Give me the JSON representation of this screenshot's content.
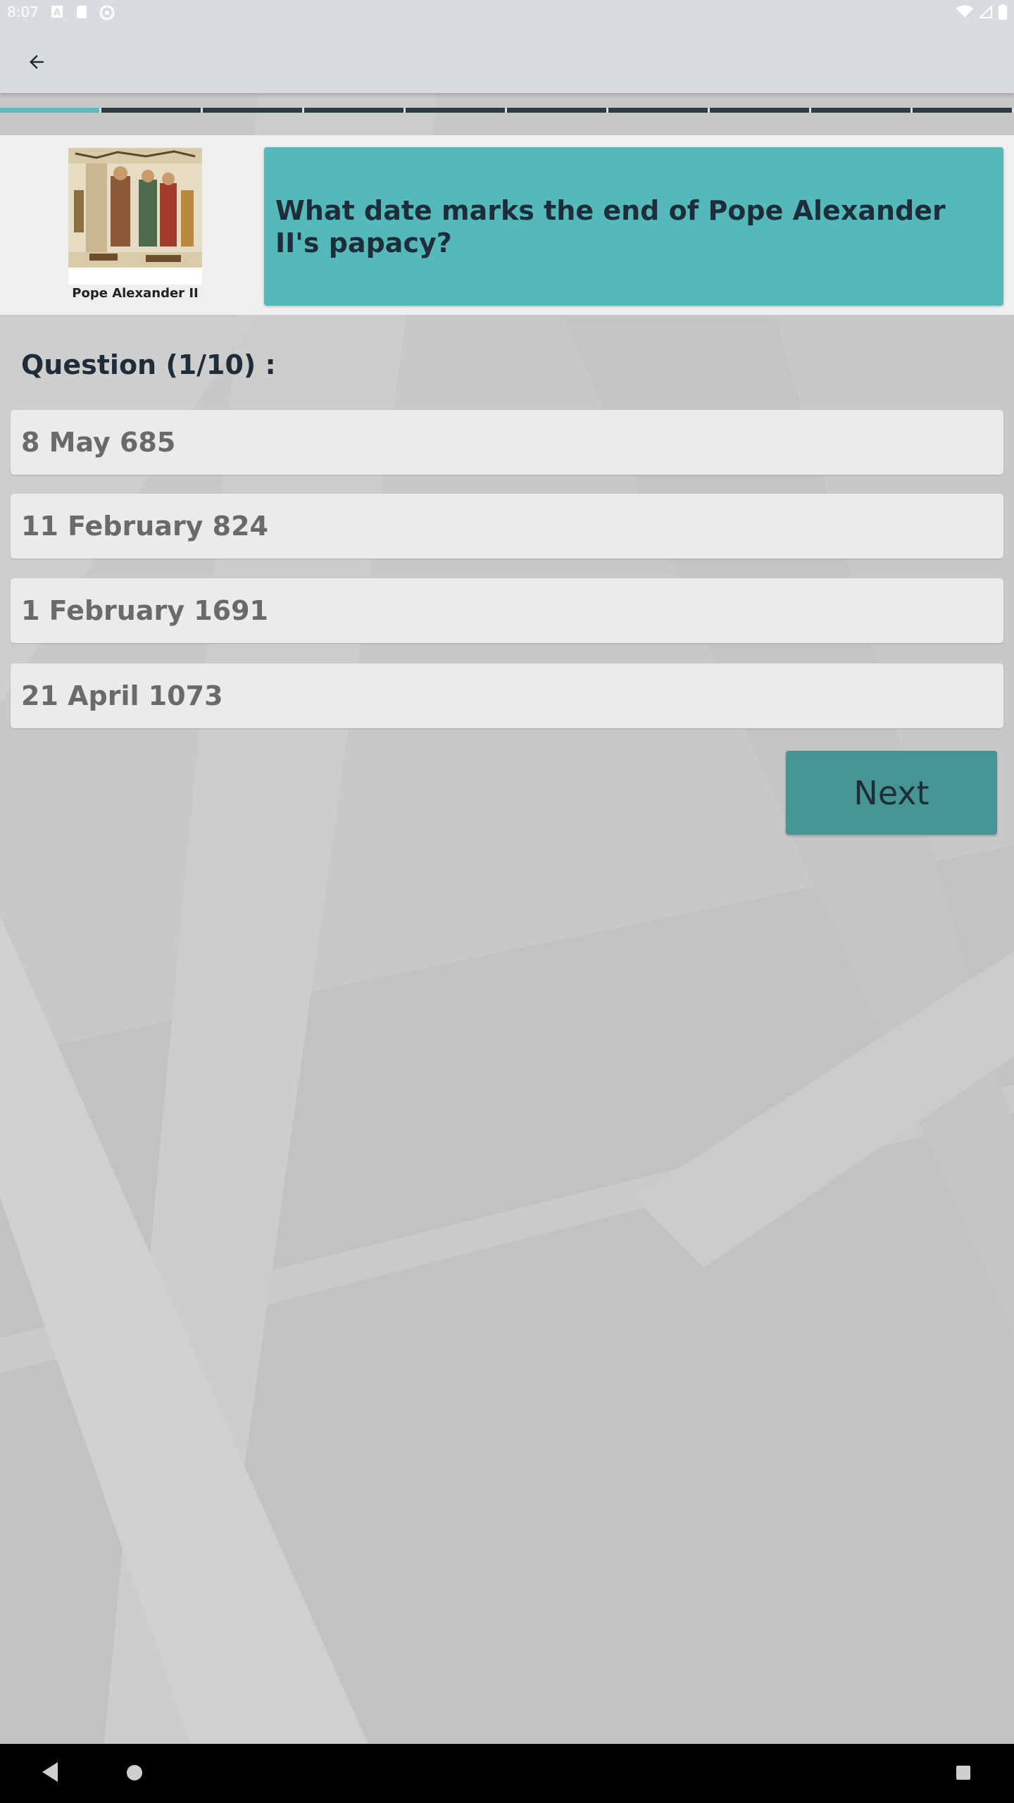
{
  "status_bar": {
    "time": "8:07",
    "left_icons": [
      "a-icon",
      "sd-card-icon",
      "sync-icon"
    ],
    "right_icons": [
      "wifi-icon",
      "signal-icon",
      "battery-icon"
    ]
  },
  "app_bar": {
    "back_icon": "arrow-back-icon"
  },
  "progress": {
    "total": 10,
    "current": 1,
    "active_color": "#58bcba",
    "inactive_color": "#2b3e3c"
  },
  "question": {
    "image_caption": "Pope Alexander II",
    "text": "What date marks the end of Pope Alexander II's papacy?",
    "counter": "Question (1/10) :"
  },
  "answers": [
    {
      "label": "8 May 685"
    },
    {
      "label": "11 February 824"
    },
    {
      "label": "1 February 1691"
    },
    {
      "label": "21 April 1073"
    }
  ],
  "next_button": {
    "label": "Next"
  },
  "colors": {
    "accent": "#54b9b8",
    "button": "#479592",
    "text_dark": "#1f2d3a"
  }
}
